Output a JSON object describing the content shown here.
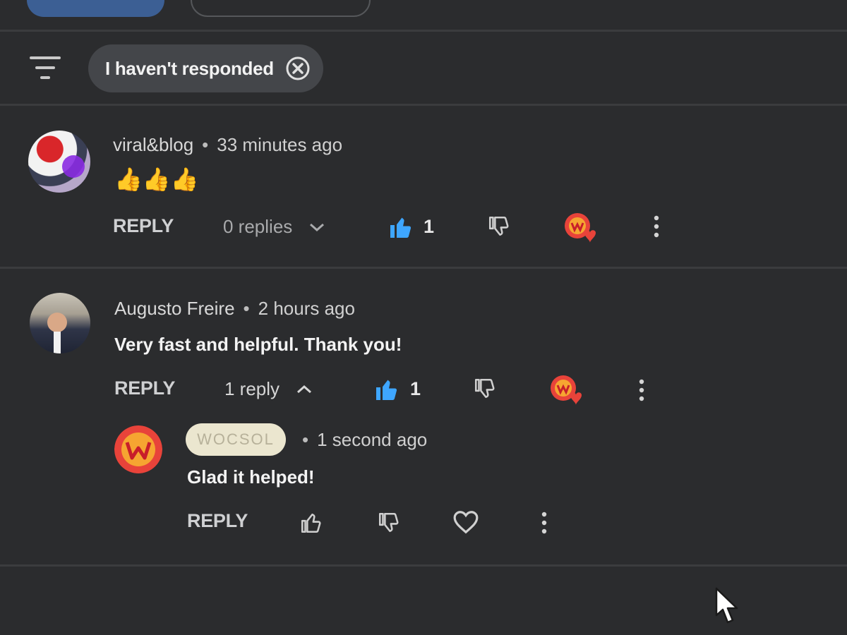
{
  "filter": {
    "icon": "filter-icon",
    "chip_label": "I haven't responded",
    "chip_close_icon": "close-circle-icon"
  },
  "comments": [
    {
      "author": "viral&blog",
      "time": "33 minutes ago",
      "text": "👍👍👍",
      "reply_label": "REPLY",
      "replies_label": "0 replies",
      "replies_icon": "chevron-down-icon",
      "like_count": "1",
      "liked": true
    },
    {
      "author": "Augusto Freire",
      "time": "2 hours ago",
      "text": "Very fast and helpful. Thank you!",
      "reply_label": "REPLY",
      "replies_label": "1 reply",
      "replies_icon": "chevron-up-icon",
      "like_count": "1",
      "liked": true
    }
  ],
  "reply": {
    "author_badge": "WOCSOL",
    "time": "1 second ago",
    "text": "Glad it helped!",
    "reply_label": "REPLY"
  },
  "separator": "•",
  "colors": {
    "background": "#2b2c2e",
    "like_active": "#3ea6ff",
    "heart_brand": "#e8433a",
    "badge_bg": "#ebe6cf"
  }
}
